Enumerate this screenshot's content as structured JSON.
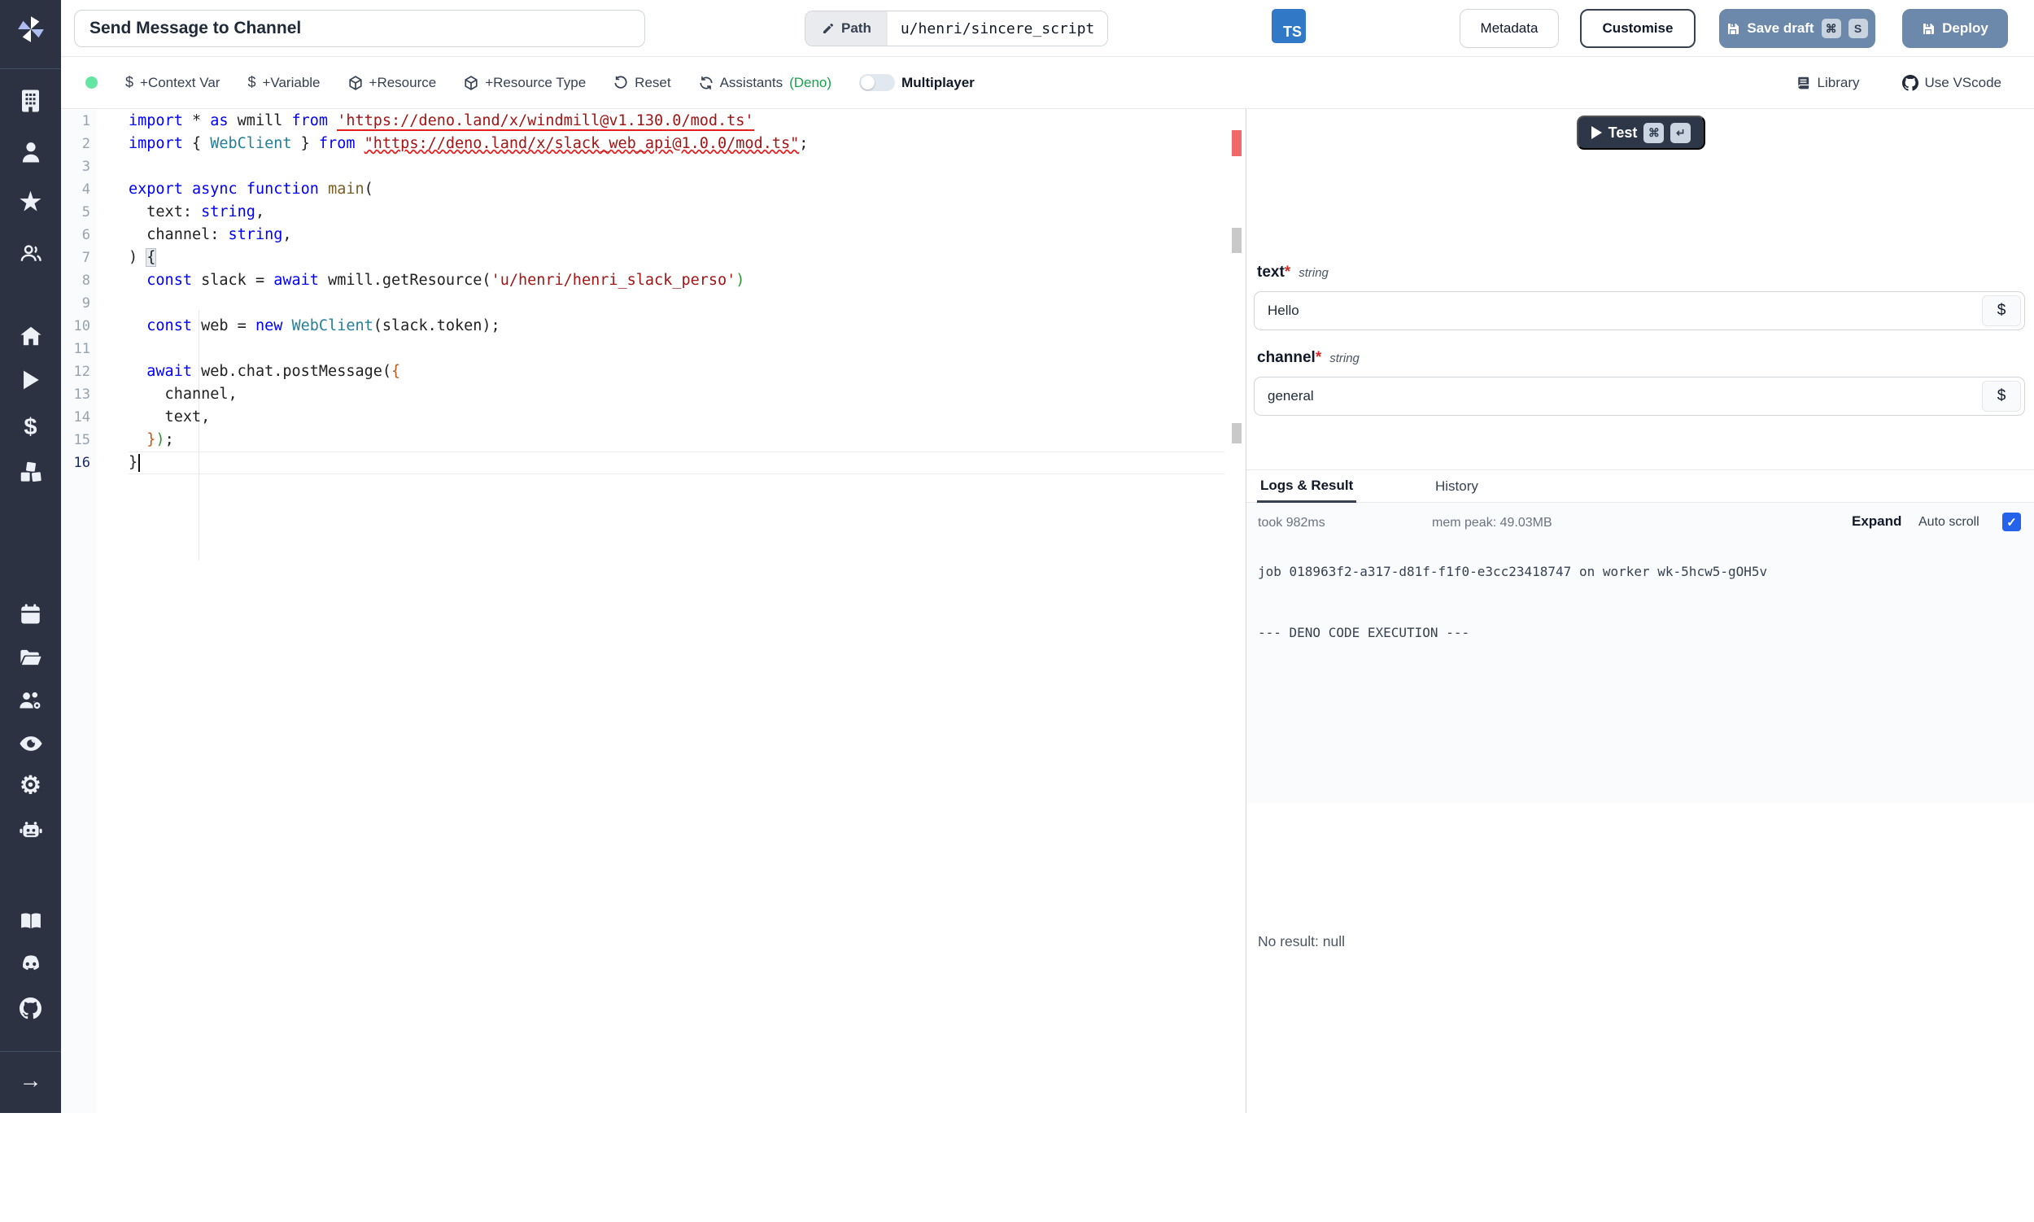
{
  "header": {
    "title_value": "Send Message to Channel",
    "path_label": "Path",
    "path_value": "u/henri/sincere_script",
    "lang_badge": "TS",
    "metadata_label": "Metadata",
    "customise_label": "Customise",
    "save_draft_label": "Save draft",
    "save_kbd": [
      "⌘",
      "S"
    ],
    "deploy_label": "Deploy"
  },
  "toolbar": {
    "dollar_icon": "$",
    "context_var_label": "+Context Var",
    "variable_label": "+Variable",
    "resource_label": "+Resource",
    "resource_type_label": "+Resource Type",
    "reset_label": "Reset",
    "assistants_label": "Assistants",
    "assistants_lang": "(Deno)",
    "multiplayer_label": "Multiplayer",
    "library_label": "Library",
    "use_vscode_label": "Use VScode"
  },
  "sidebar": {
    "icons": [
      "windmill-logo",
      "workspace",
      "user",
      "favorites",
      "users",
      "home",
      "runs",
      "variables",
      "resources",
      "schedules",
      "folders",
      "groups",
      "audit-logs",
      "settings",
      "workers",
      "docs",
      "discord",
      "github",
      "expand"
    ]
  },
  "editor": {
    "language": "typescript",
    "active_line": 16,
    "lines": [
      {
        "n": 1,
        "tokens": [
          [
            "k",
            "import"
          ],
          [
            "d",
            " * "
          ],
          [
            "k",
            "as"
          ],
          [
            "d",
            " wmill "
          ],
          [
            "k",
            "from"
          ],
          [
            "d",
            " "
          ],
          [
            "su",
            "'https://deno.land/x/windmill@v1.130.0/mod.ts'"
          ]
        ]
      },
      {
        "n": 2,
        "tokens": [
          [
            "k",
            "import"
          ],
          [
            "d",
            " { "
          ],
          [
            "c",
            "WebClient"
          ],
          [
            "d",
            " } "
          ],
          [
            "k",
            "from"
          ],
          [
            "d",
            " "
          ],
          [
            "sw",
            "\"https://deno.land/x/slack_web_api@1.0.0/mod.ts\""
          ],
          [
            "d",
            ";"
          ]
        ]
      },
      {
        "n": 3,
        "tokens": []
      },
      {
        "n": 4,
        "tokens": [
          [
            "k",
            "export"
          ],
          [
            "d",
            " "
          ],
          [
            "k",
            "async"
          ],
          [
            "d",
            " "
          ],
          [
            "k",
            "function"
          ],
          [
            "d",
            " "
          ],
          [
            "f",
            "main"
          ],
          [
            "d",
            "("
          ]
        ]
      },
      {
        "n": 5,
        "tokens": [
          [
            "d",
            "  text: "
          ],
          [
            "k",
            "string"
          ],
          [
            "d",
            ","
          ]
        ]
      },
      {
        "n": 6,
        "tokens": [
          [
            "d",
            "  channel: "
          ],
          [
            "k",
            "string"
          ],
          [
            "d",
            ","
          ]
        ]
      },
      {
        "n": 7,
        "tokens": [
          [
            "d",
            ") "
          ],
          [
            "bm",
            "{"
          ]
        ]
      },
      {
        "n": 8,
        "tokens": [
          [
            "d",
            "  "
          ],
          [
            "k",
            "const"
          ],
          [
            "d",
            " slack = "
          ],
          [
            "k",
            "await"
          ],
          [
            "d",
            " wmill.getResource("
          ],
          [
            "s",
            "'u/henri/henri_slack_perso'"
          ],
          [
            "g",
            ")"
          ]
        ]
      },
      {
        "n": 9,
        "tokens": []
      },
      {
        "n": 10,
        "tokens": [
          [
            "d",
            "  "
          ],
          [
            "k",
            "const"
          ],
          [
            "d",
            " web = "
          ],
          [
            "k",
            "new"
          ],
          [
            "d",
            " "
          ],
          [
            "c",
            "WebClient"
          ],
          [
            "d",
            "(slack.token);"
          ]
        ]
      },
      {
        "n": 11,
        "tokens": []
      },
      {
        "n": 12,
        "tokens": [
          [
            "d",
            "  "
          ],
          [
            "k",
            "await"
          ],
          [
            "d",
            " web.chat.postMessage("
          ],
          [
            "o",
            "{"
          ]
        ]
      },
      {
        "n": 13,
        "tokens": [
          [
            "d",
            "    channel,"
          ]
        ]
      },
      {
        "n": 14,
        "tokens": [
          [
            "d",
            "    text,"
          ]
        ]
      },
      {
        "n": 15,
        "tokens": [
          [
            "d",
            "  "
          ],
          [
            "o",
            "}"
          ],
          [
            "g",
            ")"
          ],
          [
            "d",
            ";"
          ]
        ]
      },
      {
        "n": 16,
        "tokens": [
          [
            "d",
            "}"
          ]
        ],
        "active": true,
        "caret": true
      }
    ]
  },
  "right_panel": {
    "test_label": "Test",
    "test_kbd": [
      "⌘",
      "↵"
    ],
    "required_mark": "*",
    "dollar_button": "$",
    "fields": [
      {
        "name": "text",
        "type": "string",
        "value": "Hello"
      },
      {
        "name": "channel",
        "type": "string",
        "value": "general"
      }
    ],
    "tabs": {
      "logs": "Logs & Result",
      "history": "History"
    },
    "stats": {
      "took": "took 982ms",
      "mem": "mem peak: 49.03MB",
      "expand": "Expand",
      "autoscroll": "Auto scroll",
      "autoscroll_checked": true
    },
    "logs_text": "job 018963f2-a317-d81f-f1f0-e3cc23418747 on worker wk-5hcw5-gOH5v\n\n\n--- DENO CODE EXECUTION ---",
    "result_text": "No result: null"
  },
  "colors": {
    "sidebar_bg": "#2c3242",
    "primary_button": "#6c88aa",
    "ts_badge": "#3178c6",
    "checkbox_blue": "#2563eb",
    "green_dot": "#63e6a2",
    "deno_green": "#16a34a",
    "error_red": "#e51f1f",
    "test_button": "#2d3748"
  }
}
